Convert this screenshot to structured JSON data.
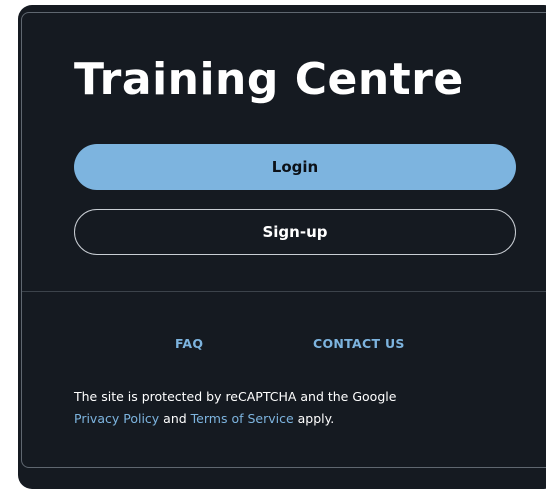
{
  "card": {
    "title": "Training Centre"
  },
  "buttons": {
    "login_label": "Login",
    "signup_label": "Sign-up"
  },
  "footer": {
    "links": [
      {
        "label": "FAQ"
      },
      {
        "label": "CONTACT US"
      }
    ],
    "notice": {
      "text_1": "The site is protected by reCAPTCHA and the Google",
      "privacy_link": "Privacy Policy",
      "text_2": " and ",
      "terms_link": "Terms of Service",
      "text_3": " apply."
    }
  },
  "colors": {
    "panel_background": "#151a21",
    "accent": "#7db4df",
    "text": "#ffffff"
  }
}
